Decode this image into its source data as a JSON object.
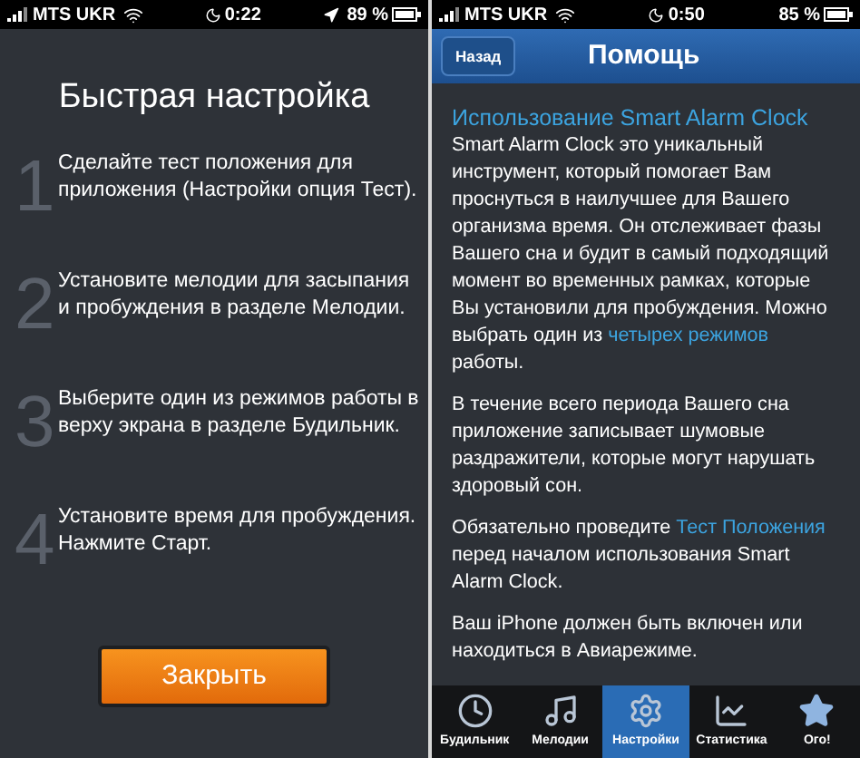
{
  "left_screen": {
    "status_bar": {
      "carrier": "MTS UKR",
      "time": "0:22",
      "location": true,
      "battery": "89 %"
    },
    "title": "Быстрая настройка",
    "steps": [
      {
        "number": "1",
        "text": "Сделайте тест положения для приложения (Настройки опция Тест)."
      },
      {
        "number": "2",
        "text": "Установите мелодии для засыпания и пробуждения в разделе Мелодии."
      },
      {
        "number": "3",
        "text": "Выберите один из режимов работы в верху экрана в разделе Будильник."
      },
      {
        "number": "4",
        "text": "Установите время для пробуждения. Нажмите Старт."
      }
    ],
    "button": "Закрыть"
  },
  "right_screen": {
    "status_bar": {
      "carrier": "MTS UKR",
      "time": "0:50",
      "battery": "85 %"
    },
    "nav_bar": {
      "back": "Назад",
      "title": "Помощь"
    },
    "heading": "Использование Smart Alarm Clock",
    "paragraphs": [
      [
        {
          "text": "Smart Alarm Clock это уникальный инструмент, который помогает Вам проснуться в наилучшее для Вашего организма время. Он отслеживает фазы Вашего сна и будит в самый подходящий момент во временных рамках, которые Вы установили для пробуждения. Можно выбрать один из ",
          "link": false
        },
        {
          "text": "четырех режимов",
          "link": true
        },
        {
          "text": " работы.",
          "link": false
        }
      ],
      [
        {
          "text": "В течение всего периода Вашего сна приложение записывает шумовые раздражители, которые могут нарушать здоровый сон.",
          "link": false
        }
      ],
      [
        {
          "text": "Обязательно проведите ",
          "link": false
        },
        {
          "text": "Тест Положения",
          "link": true
        },
        {
          "text": " перед началом использования Smart Alarm Clock.",
          "link": false
        }
      ],
      [
        {
          "text": "Ваш iPhone должен быть включен или находиться в Авиарежиме.",
          "link": false
        }
      ]
    ],
    "tabs": [
      {
        "label": "Будильник",
        "selected": false
      },
      {
        "label": "Мелодии",
        "selected": false
      },
      {
        "label": "Настройки",
        "selected": true
      },
      {
        "label": "Статистика",
        "selected": false
      },
      {
        "label": "Ого!",
        "selected": false
      }
    ]
  }
}
